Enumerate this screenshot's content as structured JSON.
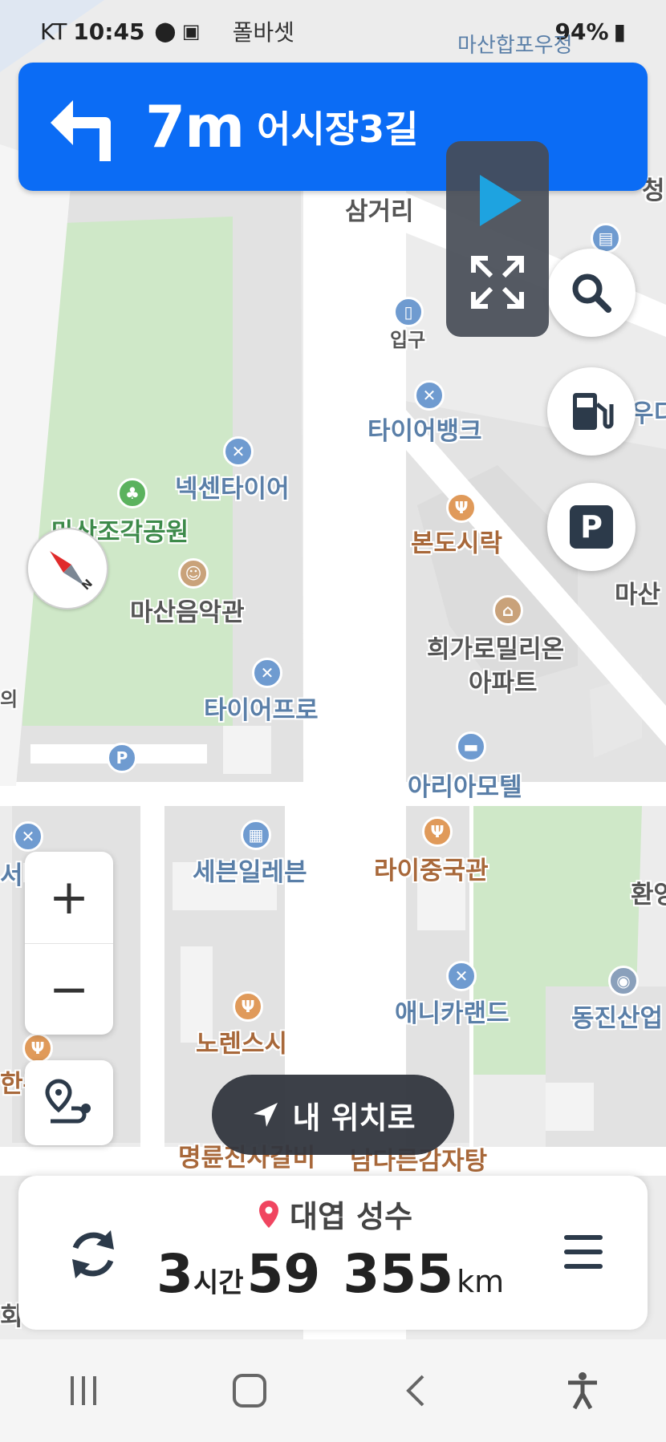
{
  "status_bar": {
    "carrier": "KT",
    "time": "10:45",
    "notif_text": "폴바셋",
    "battery": "94%",
    "overlay_text": "마산합포우정"
  },
  "banner": {
    "distance": "7m",
    "road": "어시장3길",
    "bg_color": "#0b6cf5"
  },
  "map_labels": {
    "samgeori": "삼거리",
    "entrance": "입구",
    "tire_bank": "타이어뱅크",
    "nexen": "넥센타이어",
    "park": "마산조각공원",
    "music_hall": "마산음악관",
    "bondo": "본도시락",
    "higaro_1": "희가로밀리온",
    "higaro_2": "아파트",
    "tire_pro": "타이어프로",
    "ariamotel": "아리아모텔",
    "seven_eleven": "세븐일레븐",
    "raijung": "라이중국관",
    "any_car": "애니카랜드",
    "dongjin": "동진산업",
    "noren": "노렌스시",
    "myungryun": "명륜진사갈비",
    "namdareun": "남다른감자탕",
    "masan_right": "마산",
    "hwan_right": "환영",
    "cheong_right": "청",
    "edge_left_1": "의",
    "edge_left_2": "서비",
    "edge_left_3": "한우",
    "edge_left_4": "회",
    "edge_right_1": "우디"
  },
  "buttons": {
    "my_location": "내 위치로",
    "zoom_in": "+",
    "zoom_out": "−",
    "parking": "P"
  },
  "bottom_card": {
    "destination": "대엽 성수",
    "hours": "3",
    "hours_unit": "시간",
    "minutes": "59",
    "distance": "355",
    "distance_unit": "km"
  },
  "icons": {
    "turn": "turn-left-icon",
    "play": "play-icon",
    "expand": "expand-icon",
    "search": "search-icon",
    "fuel": "fuel-station-icon",
    "parking": "parking-icon",
    "compass": "compass-icon",
    "route_options": "route-options-icon",
    "location_arrow": "location-arrow-icon",
    "refresh": "refresh-icon",
    "menu": "menu-icon",
    "pin": "destination-pin-icon",
    "recent_apps": "recent-apps-icon",
    "home": "home-icon",
    "back": "back-icon",
    "accessibility": "accessibility-icon"
  }
}
